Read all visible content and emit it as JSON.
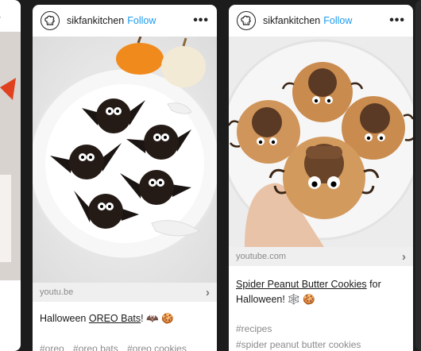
{
  "left_card": {
    "more_label": "•••",
    "arrow": "›"
  },
  "card_mid": {
    "username": "sikfankitchen",
    "follow_label": "Follow",
    "more_label": "•••",
    "link_domain": "youtu.be",
    "link_arrow": "›",
    "caption_before": "Halloween ",
    "caption_link": "OREO Bats",
    "caption_after": "! 🦇 🍪",
    "tags": [
      "#oreo",
      "#oreo bats",
      "#oreo cookies"
    ]
  },
  "card_right": {
    "username": "sikfankitchen",
    "follow_label": "Follow",
    "more_label": "•••",
    "link_domain": "youtube.com",
    "link_arrow": "›",
    "caption_link": "Spider Peanut Butter Cookies",
    "caption_after": " for Halloween! 🕸️ 🍪",
    "tags": [
      "#recipes",
      "#spider peanut butter cookies"
    ]
  },
  "colors": {
    "accent_follow": "#1a9bf0",
    "page_bg": "#1c1c1c"
  },
  "icons": {
    "avatar": "chef-hat-icon",
    "more": "more-icon",
    "chevron": "chevron-right-icon"
  }
}
